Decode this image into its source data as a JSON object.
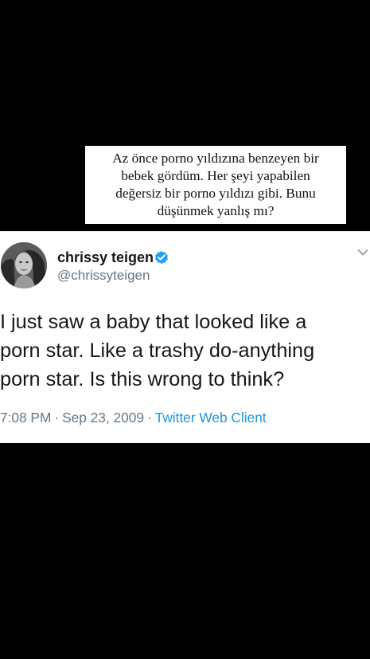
{
  "caption": {
    "lines": [
      "Az önce porno yıldızına benzeyen bir",
      "bebek gördüm. Her şeyi yapabilen",
      "değersiz bir porno yıldızı gibi. Bunu",
      "düşünmek yanlış mı?"
    ]
  },
  "tweet": {
    "display_name": "chrissy teigen",
    "handle": "@chrissyteigen",
    "verified": true,
    "text_lines": [
      "I just saw a baby that looked like a",
      "porn star. Like a trashy do-anything",
      "porn star. Is this wrong to think?"
    ],
    "time": "7:08 PM",
    "separator": "·",
    "date": "Sep 23, 2009",
    "client": "Twitter Web Client"
  },
  "colors": {
    "background": "#000000",
    "card": "#ffffff",
    "verified_blue": "#1da1f2",
    "link_blue": "#1b95e0",
    "muted_gray": "#657786",
    "text": "#14171a"
  },
  "icons": {
    "avatar": "profile-photo",
    "verified": "verified-badge-icon",
    "menu": "chevron-down-icon"
  }
}
